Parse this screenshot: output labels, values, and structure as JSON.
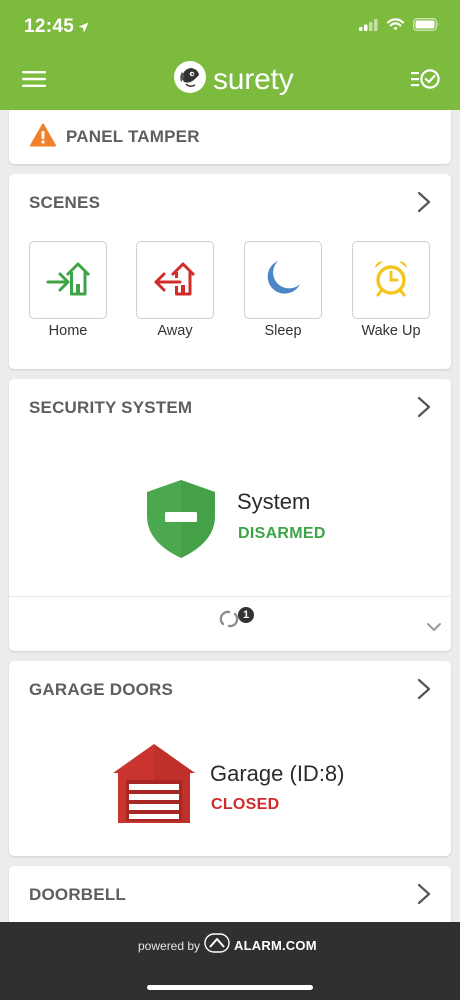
{
  "status": {
    "time": "12:45"
  },
  "brand": {
    "name": "surety"
  },
  "alert": {
    "label": "PANEL TAMPER"
  },
  "scenes": {
    "title": "SCENES",
    "items": [
      {
        "label": "Home",
        "icon": "arrive-home-icon",
        "color": "#3da447"
      },
      {
        "label": "Away",
        "icon": "leave-home-icon",
        "color": "#d12b2b"
      },
      {
        "label": "Sleep",
        "icon": "moon-icon",
        "color": "#4d86c6"
      },
      {
        "label": "Wake Up",
        "icon": "alarm-clock-icon",
        "color": "#f5c51d"
      }
    ]
  },
  "security": {
    "title": "SECURITY SYSTEM",
    "device_name": "System",
    "state": "DISARMED",
    "state_color": "#3da447",
    "pending_count": "1"
  },
  "garage": {
    "title": "GARAGE DOORS",
    "device_name": "Garage (ID:8)",
    "state": "CLOSED",
    "state_color": "#d12b2b"
  },
  "doorbell": {
    "title": "DOORBELL"
  },
  "footer": {
    "powered_by": "powered by",
    "provider": "ALARM.COM"
  }
}
